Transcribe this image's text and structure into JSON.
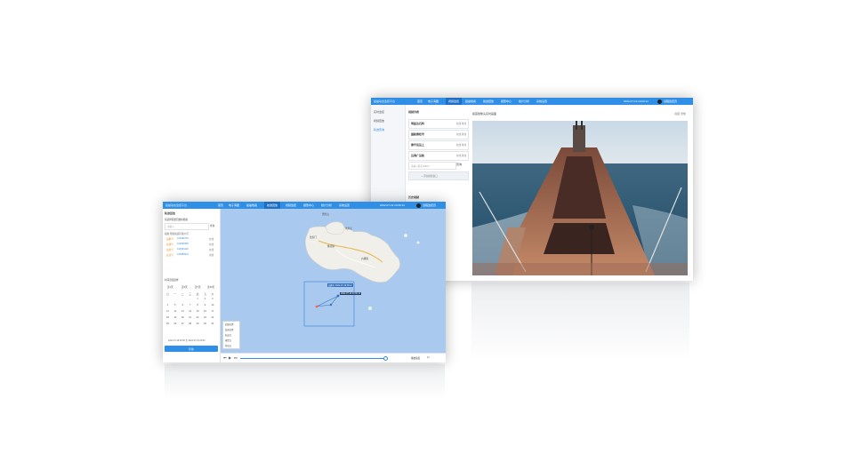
{
  "back_window": {
    "title": "船舶动态监控平台",
    "nav_tabs": [
      "首页",
      "电子海图",
      "视频监控",
      "船舶档案",
      "航迹回放",
      "报警中心",
      "统计分析",
      "系统设置"
    ],
    "active_tab": "视频监控",
    "datetime": "2022-07-19 10:00:12",
    "user": "远程监控员",
    "sidebar_items": [
      "实时监控",
      "视频回放",
      "轨迹查询"
    ],
    "list_header": "视频列表",
    "vessels": [
      {
        "name": "明星达石料",
        "status": "在线   离线"
      },
      {
        "name": "国航泰旺号",
        "status": "在线   离线"
      },
      {
        "name": "泰华货运上",
        "status": "在线   离线"
      },
      {
        "name": "远海广运航",
        "status": "在线   离线"
      }
    ],
    "search_placeholder": "请输入船名/MMSI",
    "search_button": "查询",
    "add_button": "+ 添加视频窗口",
    "record_label": "历史视频",
    "video_title": "船首摄像头实时画面",
    "video_controls": "截图  录像"
  },
  "front_window": {
    "title": "船舶动态监控平台",
    "nav_tabs": [
      "首页",
      "电子海图",
      "船舶档案",
      "航迹回放",
      "视频监控",
      "报警中心",
      "统计分析",
      "系统设置"
    ],
    "active_tab": "航迹回放",
    "datetime": "2022-07-19 10:00:12",
    "user": "远程监控员",
    "panel_title": "轨迹回放",
    "ship_label": "请选择需要回放的船舶",
    "search_placeholder": "请输入",
    "search_button": "查询",
    "ship_group_header": "船舶  所属航运有限公司",
    "ships": [
      {
        "name": "远鹏号",
        "mmsi": "413490751",
        "status": "在线"
      },
      {
        "name": "远驰号",
        "mmsi": "413250381",
        "status": "在线"
      },
      {
        "name": "远航号",
        "mmsi": "413361122",
        "status": "在线"
      },
      {
        "name": "远达号",
        "mmsi": "413580947",
        "status": "离线"
      }
    ],
    "time_label": "时间范围选择",
    "quick_buttons": [
      "近1天",
      "近3天",
      "近7天",
      "近30天"
    ],
    "calendar_header": [
      "日",
      "一",
      "二",
      "三",
      "四",
      "五",
      "六"
    ],
    "calendar_days": [
      "",
      "",
      "",
      "",
      "1",
      "2",
      "3",
      "4",
      "5",
      "6",
      "7",
      "8",
      "9",
      "10",
      "11",
      "12",
      "13",
      "14",
      "15",
      "16",
      "17",
      "18",
      "19",
      "20",
      "21",
      "22",
      "23",
      "24",
      "25",
      "26",
      "27",
      "28",
      "29",
      "30",
      "31"
    ],
    "time_range_text": "2022-07-18 00:00 至 2022-07-19 00:00",
    "confirm_button": "查询",
    "map_labels": [
      "普陀山",
      "朱家尖",
      "桃花镇",
      "六横镇",
      "沈家门"
    ],
    "track_label_1": "远鹏号 2022-07-19 08:12",
    "track_label_2": "2022-07-19 10:00:12",
    "legend": [
      "起始位置",
      "结束位置",
      "轨迹点",
      "报警点",
      "停泊点"
    ],
    "speed_label": "播放速度",
    "speed_value": "1x"
  }
}
